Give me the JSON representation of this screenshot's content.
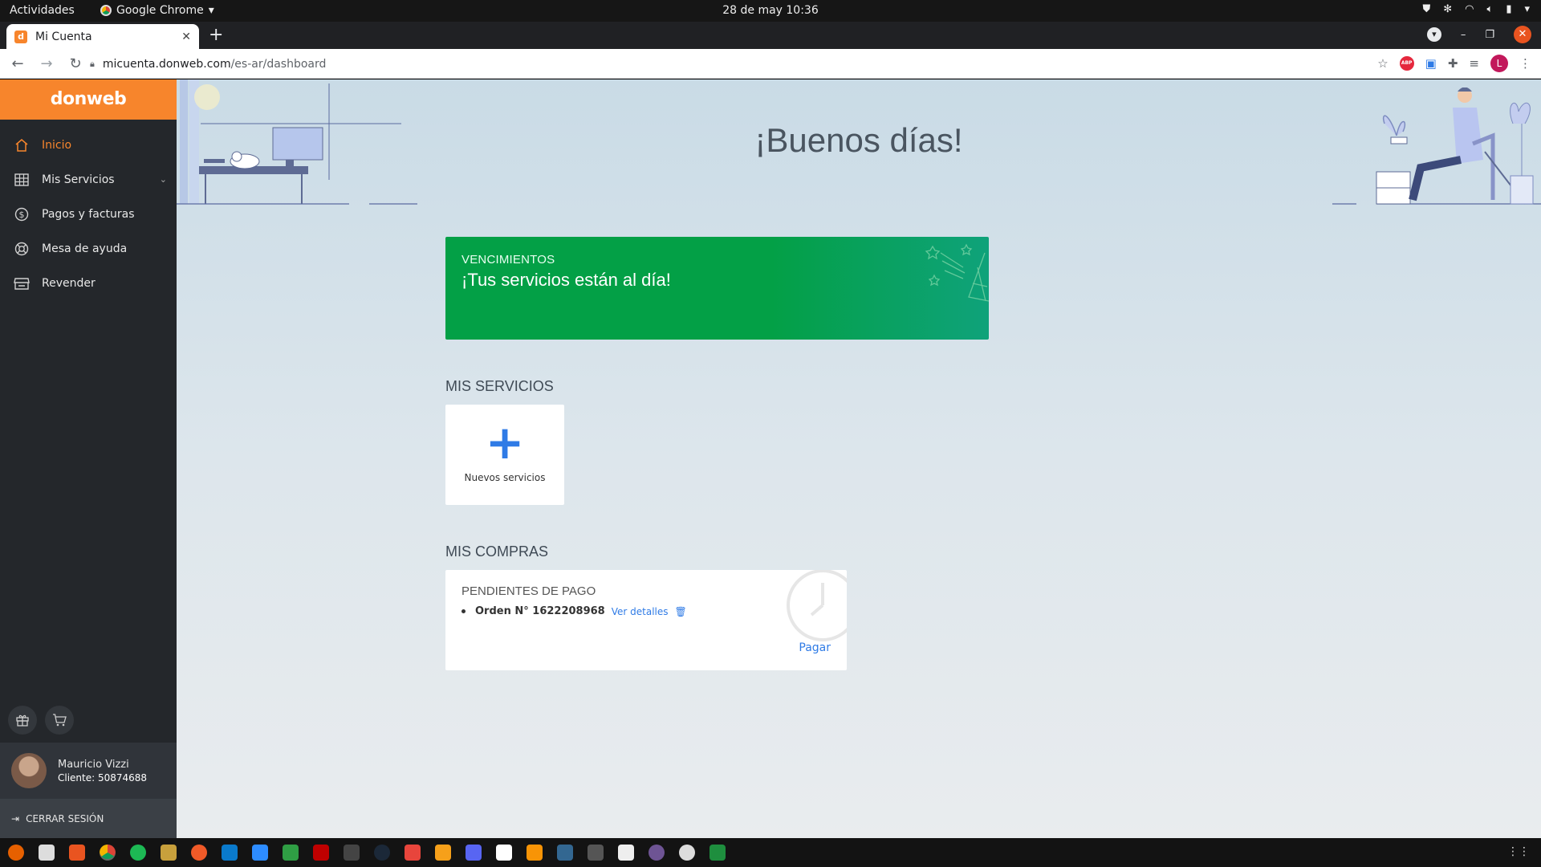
{
  "system": {
    "activities": "Actividades",
    "app_name": "Google Chrome",
    "clock": "28 de may  10:36"
  },
  "browser": {
    "tab_title": "Mi Cuenta",
    "favicon_letter": "d",
    "url_host": "micuenta.donweb.com",
    "url_path": "/es-ar/dashboard",
    "profile_letter": "L",
    "abp_label": "ABP"
  },
  "sidebar": {
    "brand": "donweb",
    "items": [
      {
        "label": "Inicio",
        "icon": "home-icon",
        "active": true
      },
      {
        "label": "Mis Servicios",
        "icon": "grid-icon",
        "active": false
      },
      {
        "label": "Pagos y facturas",
        "icon": "dollar-icon",
        "active": false
      },
      {
        "label": "Mesa de ayuda",
        "icon": "lifebuoy-icon",
        "active": false
      },
      {
        "label": "Revender",
        "icon": "store-icon",
        "active": false
      }
    ],
    "user_name": "Mauricio Vizzi",
    "user_client": "Cliente: 50874688",
    "logout": "CERRAR SESIÓN"
  },
  "main": {
    "greeting": "¡Buenos días!",
    "banner": {
      "subtitle": "VENCIMIENTOS",
      "title": "¡Tus servicios están al día!"
    },
    "services_title": "MIS SERVICIOS",
    "new_service_label": "Nuevos servicios",
    "purchases_title": "MIS COMPRAS",
    "pending_title": "PENDIENTES DE PAGO",
    "order_number": "Orden N° 1622208968",
    "order_details": "Ver detalles",
    "pay": "Pagar"
  },
  "colors": {
    "brand": "#f7852c",
    "sidebar": "#24272b",
    "banner": "#03a046",
    "link": "#2f7be6"
  }
}
